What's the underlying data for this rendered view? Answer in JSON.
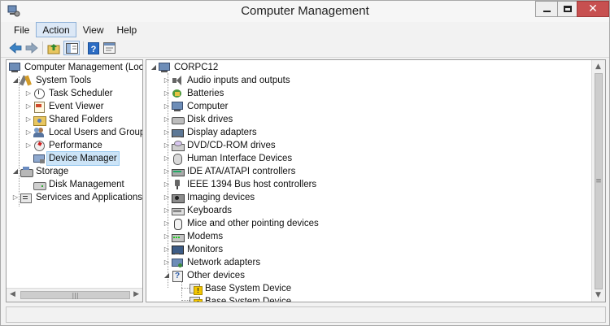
{
  "window": {
    "title": "Computer Management"
  },
  "menu": [
    "File",
    "Action",
    "View",
    "Help"
  ],
  "toolbar": {
    "buttons": [
      "back-icon",
      "forward-icon",
      "up-folder-icon",
      "show-hide-tree-icon",
      "help-icon",
      "properties-icon"
    ]
  },
  "left_tree": [
    {
      "label": "Computer Management (Local",
      "icon": "computer-icon",
      "level": 0,
      "expander": ""
    },
    {
      "label": "System Tools",
      "icon": "tools-icon",
      "level": 1,
      "expander": "expanded"
    },
    {
      "label": "Task Scheduler",
      "icon": "clock-icon",
      "level": 2,
      "expander": "collapsed"
    },
    {
      "label": "Event Viewer",
      "icon": "event-log-icon",
      "level": 2,
      "expander": "collapsed"
    },
    {
      "label": "Shared Folders",
      "icon": "shared-folder-icon",
      "level": 2,
      "expander": "collapsed"
    },
    {
      "label": "Local Users and Groups",
      "icon": "users-icon",
      "level": 2,
      "expander": "collapsed"
    },
    {
      "label": "Performance",
      "icon": "performance-icon",
      "level": 2,
      "expander": "collapsed"
    },
    {
      "label": "Device Manager",
      "icon": "device-manager-icon",
      "level": 2,
      "expander": "",
      "selected": true
    },
    {
      "label": "Storage",
      "icon": "storage-icon",
      "level": 1,
      "expander": "expanded"
    },
    {
      "label": "Disk Management",
      "icon": "disk-icon",
      "level": 2,
      "expander": ""
    },
    {
      "label": "Services and Applications",
      "icon": "services-icon",
      "level": 1,
      "expander": "collapsed"
    }
  ],
  "right_tree": {
    "root": "CORPC12",
    "categories": [
      {
        "label": "Audio inputs and outputs",
        "icon": "speaker-icon"
      },
      {
        "label": "Batteries",
        "icon": "battery-icon"
      },
      {
        "label": "Computer",
        "icon": "computer-icon"
      },
      {
        "label": "Disk drives",
        "icon": "disk-drive-icon"
      },
      {
        "label": "Display adapters",
        "icon": "display-adapter-icon"
      },
      {
        "label": "DVD/CD-ROM drives",
        "icon": "dvd-icon"
      },
      {
        "label": "Human Interface Devices",
        "icon": "hid-icon"
      },
      {
        "label": "IDE ATA/ATAPI controllers",
        "icon": "ide-controller-icon"
      },
      {
        "label": "IEEE 1394 Bus host controllers",
        "icon": "ieee1394-icon"
      },
      {
        "label": "Imaging devices",
        "icon": "camera-icon"
      },
      {
        "label": "Keyboards",
        "icon": "keyboard-icon"
      },
      {
        "label": "Mice and other pointing devices",
        "icon": "mouse-icon"
      },
      {
        "label": "Modems",
        "icon": "modem-icon"
      },
      {
        "label": "Monitors",
        "icon": "monitor-icon"
      },
      {
        "label": "Network adapters",
        "icon": "network-adapter-icon"
      },
      {
        "label": "Other devices",
        "icon": "unknown-device-icon",
        "expanded": true
      }
    ],
    "other_devices": [
      {
        "label": "Base System Device",
        "icon": "warning-device-icon"
      },
      {
        "label": "Base System Device",
        "icon": "warning-device-icon"
      }
    ]
  },
  "colors": {
    "close_button": "#c75050",
    "selection": "#cce4f7",
    "warning": "#f2c500"
  }
}
